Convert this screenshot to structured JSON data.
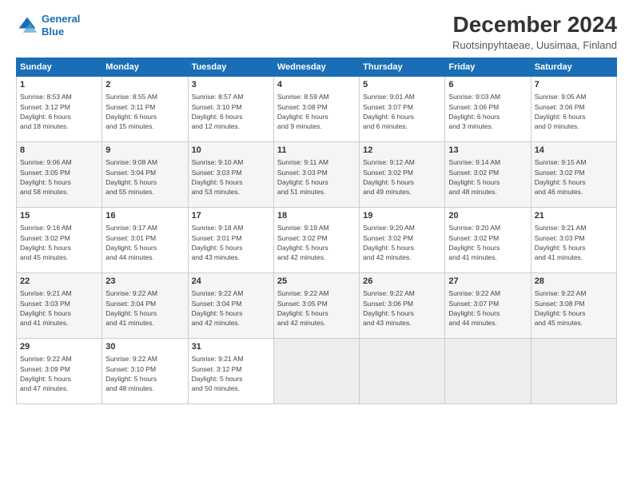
{
  "header": {
    "logo_line1": "General",
    "logo_line2": "Blue",
    "title": "December 2024",
    "subtitle": "Ruotsinpyhtaeae, Uusimaa, Finland"
  },
  "days_of_week": [
    "Sunday",
    "Monday",
    "Tuesday",
    "Wednesday",
    "Thursday",
    "Friday",
    "Saturday"
  ],
  "weeks": [
    [
      {
        "day": "1",
        "info": "Sunrise: 8:53 AM\nSunset: 3:12 PM\nDaylight: 6 hours\nand 18 minutes."
      },
      {
        "day": "2",
        "info": "Sunrise: 8:55 AM\nSunset: 3:11 PM\nDaylight: 6 hours\nand 15 minutes."
      },
      {
        "day": "3",
        "info": "Sunrise: 8:57 AM\nSunset: 3:10 PM\nDaylight: 6 hours\nand 12 minutes."
      },
      {
        "day": "4",
        "info": "Sunrise: 8:59 AM\nSunset: 3:08 PM\nDaylight: 6 hours\nand 9 minutes."
      },
      {
        "day": "5",
        "info": "Sunrise: 9:01 AM\nSunset: 3:07 PM\nDaylight: 6 hours\nand 6 minutes."
      },
      {
        "day": "6",
        "info": "Sunrise: 9:03 AM\nSunset: 3:06 PM\nDaylight: 6 hours\nand 3 minutes."
      },
      {
        "day": "7",
        "info": "Sunrise: 9:05 AM\nSunset: 3:06 PM\nDaylight: 6 hours\nand 0 minutes."
      }
    ],
    [
      {
        "day": "8",
        "info": "Sunrise: 9:06 AM\nSunset: 3:05 PM\nDaylight: 5 hours\nand 58 minutes."
      },
      {
        "day": "9",
        "info": "Sunrise: 9:08 AM\nSunset: 3:04 PM\nDaylight: 5 hours\nand 55 minutes."
      },
      {
        "day": "10",
        "info": "Sunrise: 9:10 AM\nSunset: 3:03 PM\nDaylight: 5 hours\nand 53 minutes."
      },
      {
        "day": "11",
        "info": "Sunrise: 9:11 AM\nSunset: 3:03 PM\nDaylight: 5 hours\nand 51 minutes."
      },
      {
        "day": "12",
        "info": "Sunrise: 9:12 AM\nSunset: 3:02 PM\nDaylight: 5 hours\nand 49 minutes."
      },
      {
        "day": "13",
        "info": "Sunrise: 9:14 AM\nSunset: 3:02 PM\nDaylight: 5 hours\nand 48 minutes."
      },
      {
        "day": "14",
        "info": "Sunrise: 9:15 AM\nSunset: 3:02 PM\nDaylight: 5 hours\nand 46 minutes."
      }
    ],
    [
      {
        "day": "15",
        "info": "Sunrise: 9:16 AM\nSunset: 3:02 PM\nDaylight: 5 hours\nand 45 minutes."
      },
      {
        "day": "16",
        "info": "Sunrise: 9:17 AM\nSunset: 3:01 PM\nDaylight: 5 hours\nand 44 minutes."
      },
      {
        "day": "17",
        "info": "Sunrise: 9:18 AM\nSunset: 3:01 PM\nDaylight: 5 hours\nand 43 minutes."
      },
      {
        "day": "18",
        "info": "Sunrise: 9:19 AM\nSunset: 3:02 PM\nDaylight: 5 hours\nand 42 minutes."
      },
      {
        "day": "19",
        "info": "Sunrise: 9:20 AM\nSunset: 3:02 PM\nDaylight: 5 hours\nand 42 minutes."
      },
      {
        "day": "20",
        "info": "Sunrise: 9:20 AM\nSunset: 3:02 PM\nDaylight: 5 hours\nand 41 minutes."
      },
      {
        "day": "21",
        "info": "Sunrise: 9:21 AM\nSunset: 3:03 PM\nDaylight: 5 hours\nand 41 minutes."
      }
    ],
    [
      {
        "day": "22",
        "info": "Sunrise: 9:21 AM\nSunset: 3:03 PM\nDaylight: 5 hours\nand 41 minutes."
      },
      {
        "day": "23",
        "info": "Sunrise: 9:22 AM\nSunset: 3:04 PM\nDaylight: 5 hours\nand 41 minutes."
      },
      {
        "day": "24",
        "info": "Sunrise: 9:22 AM\nSunset: 3:04 PM\nDaylight: 5 hours\nand 42 minutes."
      },
      {
        "day": "25",
        "info": "Sunrise: 9:22 AM\nSunset: 3:05 PM\nDaylight: 5 hours\nand 42 minutes."
      },
      {
        "day": "26",
        "info": "Sunrise: 9:22 AM\nSunset: 3:06 PM\nDaylight: 5 hours\nand 43 minutes."
      },
      {
        "day": "27",
        "info": "Sunrise: 9:22 AM\nSunset: 3:07 PM\nDaylight: 5 hours\nand 44 minutes."
      },
      {
        "day": "28",
        "info": "Sunrise: 9:22 AM\nSunset: 3:08 PM\nDaylight: 5 hours\nand 45 minutes."
      }
    ],
    [
      {
        "day": "29",
        "info": "Sunrise: 9:22 AM\nSunset: 3:09 PM\nDaylight: 5 hours\nand 47 minutes."
      },
      {
        "day": "30",
        "info": "Sunrise: 9:22 AM\nSunset: 3:10 PM\nDaylight: 5 hours\nand 48 minutes."
      },
      {
        "day": "31",
        "info": "Sunrise: 9:21 AM\nSunset: 3:12 PM\nDaylight: 5 hours\nand 50 minutes."
      },
      null,
      null,
      null,
      null
    ]
  ]
}
